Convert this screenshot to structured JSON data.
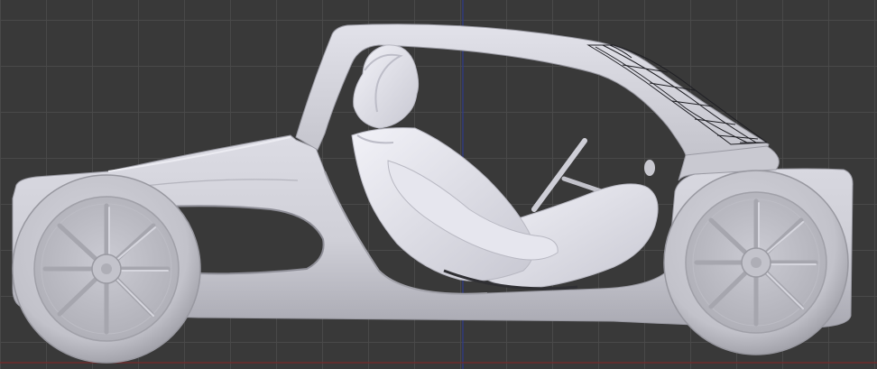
{
  "viewport": {
    "type": "3d-orthographic-side-view",
    "background_color": "#393939",
    "grid_color": "#4a4a4a",
    "axis_vertical_color": "#2d3a8c",
    "axis_horizontal_color": "#7a2a2a",
    "model_color": "#d0d0d8"
  },
  "scene": {
    "object": "car-chassis-with-seated-driver",
    "parts": [
      "car-body",
      "front-wheel",
      "rear-wheel",
      "windshield-wireframe",
      "steering-wheel",
      "driver-figure"
    ]
  }
}
